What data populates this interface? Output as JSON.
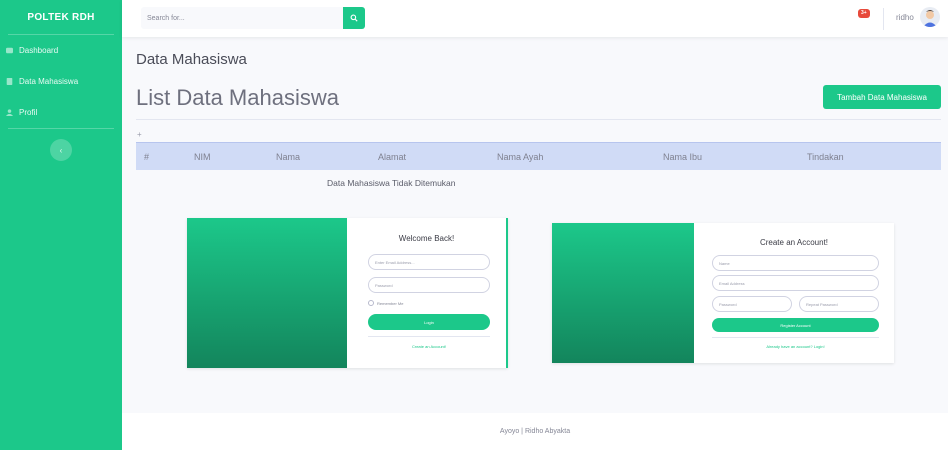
{
  "sidebar": {
    "brand": "POLTEK RDH",
    "items": [
      {
        "label": "Dashboard",
        "icon": "dashboard-icon"
      },
      {
        "label": "Data Mahasiswa",
        "icon": "table-icon"
      },
      {
        "label": "Profil",
        "icon": "user-icon"
      }
    ],
    "toggle_glyph": "‹"
  },
  "topbar": {
    "search_placeholder": "Search for...",
    "alert_badge": "3+",
    "username": "ridho"
  },
  "main": {
    "page_title": "Data Mahasiswa",
    "list_title": "List Data Mahasiswa",
    "add_button": "Tambah Data Mahasiswa",
    "plus": "+",
    "table_headers": [
      "#",
      "NIM",
      "Nama",
      "Alamat",
      "Nama Ayah",
      "Nama Ibu",
      "Tindakan"
    ],
    "empty_message": "Data Mahasiswa Tidak Ditemukan"
  },
  "login_card": {
    "title": "Welcome Back!",
    "email_placeholder": "Enter Email Address...",
    "password_placeholder": "Password",
    "remember_label": "Remember Me",
    "login_button": "Login",
    "create_link": "Create an Account!"
  },
  "register_card": {
    "title": "Create an Account!",
    "name_placeholder": "Name",
    "email_placeholder": "Email Address",
    "password_placeholder": "Password",
    "repeat_placeholder": "Repeat Password",
    "register_button": "Register Account",
    "login_link": "Already have an account? Login!"
  },
  "footer": {
    "text": "Ayoyo | Ridho Abyakta"
  },
  "colors": {
    "accent": "#1cc88a",
    "table_header": "#d0dbf6",
    "badge": "#e74a3b"
  }
}
